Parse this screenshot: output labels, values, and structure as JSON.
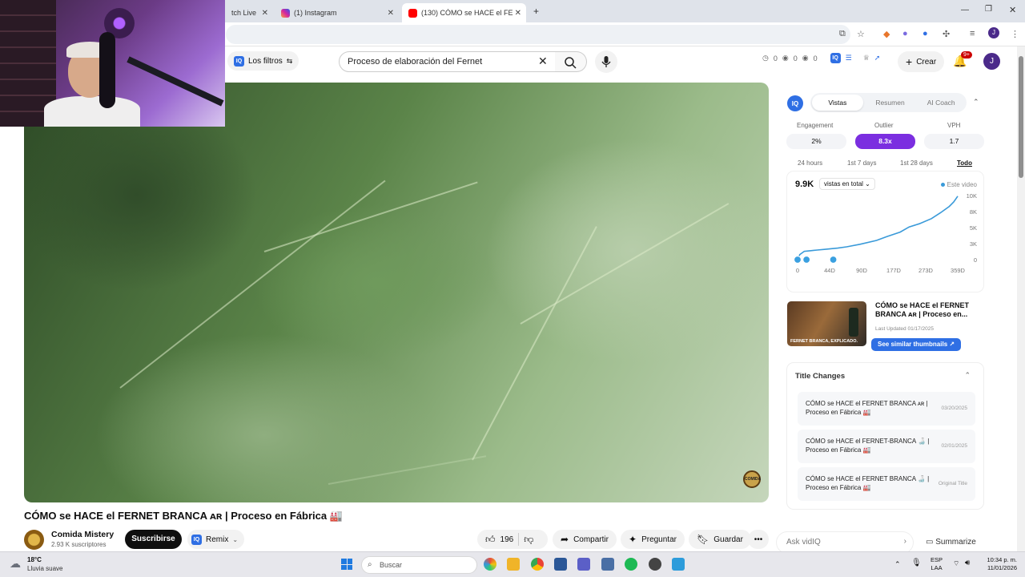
{
  "browser": {
    "tabs": [
      {
        "label": "tch Live",
        "active": false
      },
      {
        "label": "(1) Instagram",
        "active": false
      },
      {
        "label": "(130) CÓMO se HACE el FERNE",
        "active": true
      }
    ],
    "new_tab": "+"
  },
  "youtube": {
    "filters_label": "Los filtros",
    "search_value": "Proceso de elaboración del Fernet",
    "stats": [
      "0",
      "0",
      "0"
    ],
    "create_label": "Crear",
    "notifications_badge": "9+",
    "avatar_letter": "J"
  },
  "video": {
    "title": "CÓMO se HACE el FERNET BRANCA ᴀʀ | Proceso en Fábrica 🏭",
    "channel_name": "Comida Mistery",
    "subscribers": "2.93 K suscriptores",
    "subscribe_label": "Suscribirse",
    "remix_label": "Remix",
    "likes": "196",
    "share_label": "Compartir",
    "ask_label": "Preguntar",
    "save_label": "Guardar",
    "logo_text": "COMIDA"
  },
  "vidiq": {
    "tabs": [
      "Vistas",
      "Resumen",
      "AI Coach"
    ],
    "active_tab": "Vistas",
    "metrics": [
      {
        "label": "Engagement",
        "value": "2%"
      },
      {
        "label": "Outlier",
        "value": "8.3x",
        "highlight": true
      },
      {
        "label": "VPH",
        "value": "1.7"
      }
    ],
    "ranges": [
      "24 hours",
      "1st 7 days",
      "1st 28 days",
      "Todo"
    ],
    "active_range": "Todo",
    "views_total": "9.9K",
    "views_select": "vistas en total",
    "legend": "Este video",
    "thumbnail": {
      "title": "CÓMO se HACE el FERNET BRANCA ᴀʀ | Proceso en...",
      "updated": "Last Updated 01/17/2025",
      "overlay_text": "FERNET BRANCA, EXPLICADO.",
      "similar_label": "See similar thumbnails ↗"
    },
    "title_changes": {
      "heading": "Title Changes",
      "rows": [
        {
          "title": "CÓMO se HACE el FERNET BRANCA ᴀʀ | Proceso en Fábrica 🏭",
          "date": "03/20/2025"
        },
        {
          "title": "CÓMO se HACE el FERNET-BRANCA 🍶 | Proceso en Fábrica 🏭",
          "date": "02/01/2025"
        },
        {
          "title": "CÓMO se HACE el FERNET BRANCA 🍶 | Proceso en Fábrica 🏭",
          "date": "Original Title"
        }
      ]
    },
    "ask_placeholder": "Ask vidIQ",
    "summarize_label": "Summarize"
  },
  "chart_data": {
    "type": "line",
    "title": "",
    "x_tick_labels": [
      "0",
      "44D",
      "90D",
      "177D",
      "273D",
      "359D"
    ],
    "y_tick_labels": [
      "0",
      "3K",
      "5K",
      "8K",
      "10K"
    ],
    "ylim": [
      0,
      10000
    ],
    "xlim": [
      0,
      359
    ],
    "series": [
      {
        "name": "Este video",
        "color": "#3a9ad9",
        "x": [
          0,
          5,
          15,
          30,
          44,
          60,
          90,
          110,
          140,
          177,
          200,
          230,
          250,
          273,
          300,
          320,
          340,
          350,
          359
        ],
        "y": [
          0,
          800,
          1300,
          1400,
          1500,
          1600,
          1800,
          2000,
          2400,
          3000,
          3600,
          4300,
          5100,
          5600,
          6400,
          7300,
          8300,
          9000,
          9900
        ]
      }
    ],
    "markers_x": [
      0,
      20,
      80
    ],
    "grid": false,
    "legend_position": "top-right"
  },
  "taskbar": {
    "weather_temp": "18°C",
    "weather_desc": "Lluvia suave",
    "search_placeholder": "Buscar",
    "lang_top": "ESP",
    "lang_bottom": "LAA",
    "time": "10:34 p. m.",
    "date": "11/01/2026"
  },
  "colors": {
    "vidiq_blue": "#2f6fe4",
    "outlier_purple": "#7b2ee0",
    "chart_line": "#3a9ad9"
  }
}
